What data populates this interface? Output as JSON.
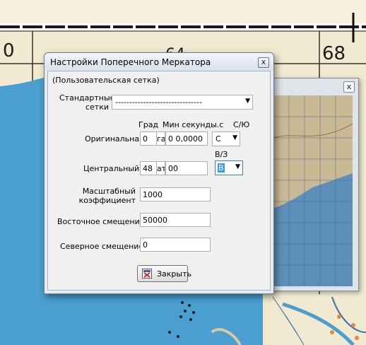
{
  "map": {
    "grid_numbers": [
      "0",
      "64",
      "68"
    ]
  },
  "thumbnail_window": {
    "close_symbol": "x"
  },
  "dialog": {
    "title": "Настройки Поперечного Меркатора",
    "close_symbol": "x",
    "grid_name": "(Пользовательская сетка)",
    "standard_grids": {
      "label_line1": "Стандартные",
      "label_line2": "сетки",
      "value": "-------------------------------"
    },
    "columns": {
      "degrees": "Град",
      "minutes_seconds": "Мин секунды.с",
      "hemisphere_ns": "С/Ю",
      "hemisphere_ew": "В/З"
    },
    "original": {
      "label": "Оригинальная",
      "degrees": "0",
      "minutes": "га",
      "seconds": "0 0,0000",
      "hemisphere": "С"
    },
    "central": {
      "label": "Центральный ме",
      "degrees": "48",
      "minutes": "ат",
      "seconds": "00",
      "hemisphere": "В"
    },
    "scale": {
      "label_line1": "Масштабный",
      "label_line2": "коэффициент",
      "value": "1000"
    },
    "east_offset": {
      "label": "Восточное смещение",
      "value": "50000"
    },
    "north_offset": {
      "label": "Северное смещение",
      "value": "0"
    },
    "close_button_label": "Закрыть"
  },
  "colors": {
    "sea": "#4a9fd0",
    "land": "#f2ead0",
    "selection": "#3399ff"
  }
}
